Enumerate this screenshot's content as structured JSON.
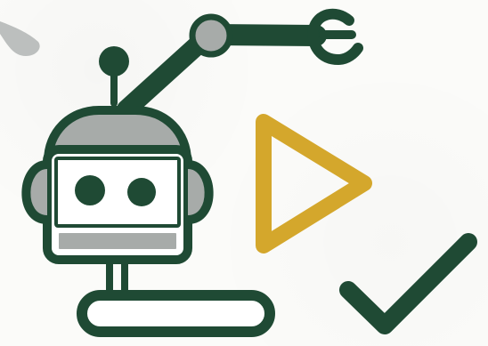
{
  "colors": {
    "background": "#fbfbf9",
    "primary_dark_green": "#1f4a34",
    "secondary_gray": "#a7aba9",
    "accent_gold": "#d4a72c",
    "white": "#ffffff"
  },
  "icons": [
    "robot-arm-icon",
    "play-icon",
    "checkmark-icon",
    "gray-blob-decoration"
  ]
}
